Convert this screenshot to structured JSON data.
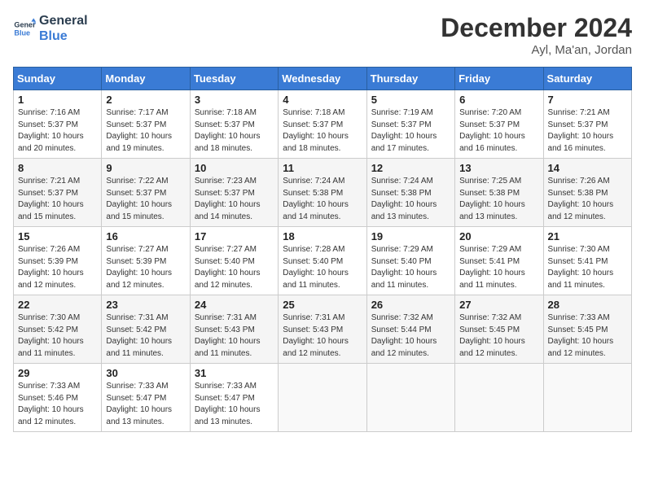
{
  "logo": {
    "text_general": "General",
    "text_blue": "Blue"
  },
  "header": {
    "month": "December 2024",
    "location": "Ayl, Ma'an, Jordan"
  },
  "weekdays": [
    "Sunday",
    "Monday",
    "Tuesday",
    "Wednesday",
    "Thursday",
    "Friday",
    "Saturday"
  ],
  "weeks": [
    [
      {
        "day": "1",
        "sunrise": "7:16 AM",
        "sunset": "5:37 PM",
        "daylight": "10 hours and 20 minutes."
      },
      {
        "day": "2",
        "sunrise": "7:17 AM",
        "sunset": "5:37 PM",
        "daylight": "10 hours and 19 minutes."
      },
      {
        "day": "3",
        "sunrise": "7:18 AM",
        "sunset": "5:37 PM",
        "daylight": "10 hours and 18 minutes."
      },
      {
        "day": "4",
        "sunrise": "7:18 AM",
        "sunset": "5:37 PM",
        "daylight": "10 hours and 18 minutes."
      },
      {
        "day": "5",
        "sunrise": "7:19 AM",
        "sunset": "5:37 PM",
        "daylight": "10 hours and 17 minutes."
      },
      {
        "day": "6",
        "sunrise": "7:20 AM",
        "sunset": "5:37 PM",
        "daylight": "10 hours and 16 minutes."
      },
      {
        "day": "7",
        "sunrise": "7:21 AM",
        "sunset": "5:37 PM",
        "daylight": "10 hours and 16 minutes."
      }
    ],
    [
      {
        "day": "8",
        "sunrise": "7:21 AM",
        "sunset": "5:37 PM",
        "daylight": "10 hours and 15 minutes."
      },
      {
        "day": "9",
        "sunrise": "7:22 AM",
        "sunset": "5:37 PM",
        "daylight": "10 hours and 15 minutes."
      },
      {
        "day": "10",
        "sunrise": "7:23 AM",
        "sunset": "5:37 PM",
        "daylight": "10 hours and 14 minutes."
      },
      {
        "day": "11",
        "sunrise": "7:24 AM",
        "sunset": "5:38 PM",
        "daylight": "10 hours and 14 minutes."
      },
      {
        "day": "12",
        "sunrise": "7:24 AM",
        "sunset": "5:38 PM",
        "daylight": "10 hours and 13 minutes."
      },
      {
        "day": "13",
        "sunrise": "7:25 AM",
        "sunset": "5:38 PM",
        "daylight": "10 hours and 13 minutes."
      },
      {
        "day": "14",
        "sunrise": "7:26 AM",
        "sunset": "5:38 PM",
        "daylight": "10 hours and 12 minutes."
      }
    ],
    [
      {
        "day": "15",
        "sunrise": "7:26 AM",
        "sunset": "5:39 PM",
        "daylight": "10 hours and 12 minutes."
      },
      {
        "day": "16",
        "sunrise": "7:27 AM",
        "sunset": "5:39 PM",
        "daylight": "10 hours and 12 minutes."
      },
      {
        "day": "17",
        "sunrise": "7:27 AM",
        "sunset": "5:40 PM",
        "daylight": "10 hours and 12 minutes."
      },
      {
        "day": "18",
        "sunrise": "7:28 AM",
        "sunset": "5:40 PM",
        "daylight": "10 hours and 11 minutes."
      },
      {
        "day": "19",
        "sunrise": "7:29 AM",
        "sunset": "5:40 PM",
        "daylight": "10 hours and 11 minutes."
      },
      {
        "day": "20",
        "sunrise": "7:29 AM",
        "sunset": "5:41 PM",
        "daylight": "10 hours and 11 minutes."
      },
      {
        "day": "21",
        "sunrise": "7:30 AM",
        "sunset": "5:41 PM",
        "daylight": "10 hours and 11 minutes."
      }
    ],
    [
      {
        "day": "22",
        "sunrise": "7:30 AM",
        "sunset": "5:42 PM",
        "daylight": "10 hours and 11 minutes."
      },
      {
        "day": "23",
        "sunrise": "7:31 AM",
        "sunset": "5:42 PM",
        "daylight": "10 hours and 11 minutes."
      },
      {
        "day": "24",
        "sunrise": "7:31 AM",
        "sunset": "5:43 PM",
        "daylight": "10 hours and 11 minutes."
      },
      {
        "day": "25",
        "sunrise": "7:31 AM",
        "sunset": "5:43 PM",
        "daylight": "10 hours and 12 minutes."
      },
      {
        "day": "26",
        "sunrise": "7:32 AM",
        "sunset": "5:44 PM",
        "daylight": "10 hours and 12 minutes."
      },
      {
        "day": "27",
        "sunrise": "7:32 AM",
        "sunset": "5:45 PM",
        "daylight": "10 hours and 12 minutes."
      },
      {
        "day": "28",
        "sunrise": "7:33 AM",
        "sunset": "5:45 PM",
        "daylight": "10 hours and 12 minutes."
      }
    ],
    [
      {
        "day": "29",
        "sunrise": "7:33 AM",
        "sunset": "5:46 PM",
        "daylight": "10 hours and 12 minutes."
      },
      {
        "day": "30",
        "sunrise": "7:33 AM",
        "sunset": "5:47 PM",
        "daylight": "10 hours and 13 minutes."
      },
      {
        "day": "31",
        "sunrise": "7:33 AM",
        "sunset": "5:47 PM",
        "daylight": "10 hours and 13 minutes."
      },
      null,
      null,
      null,
      null
    ]
  ]
}
